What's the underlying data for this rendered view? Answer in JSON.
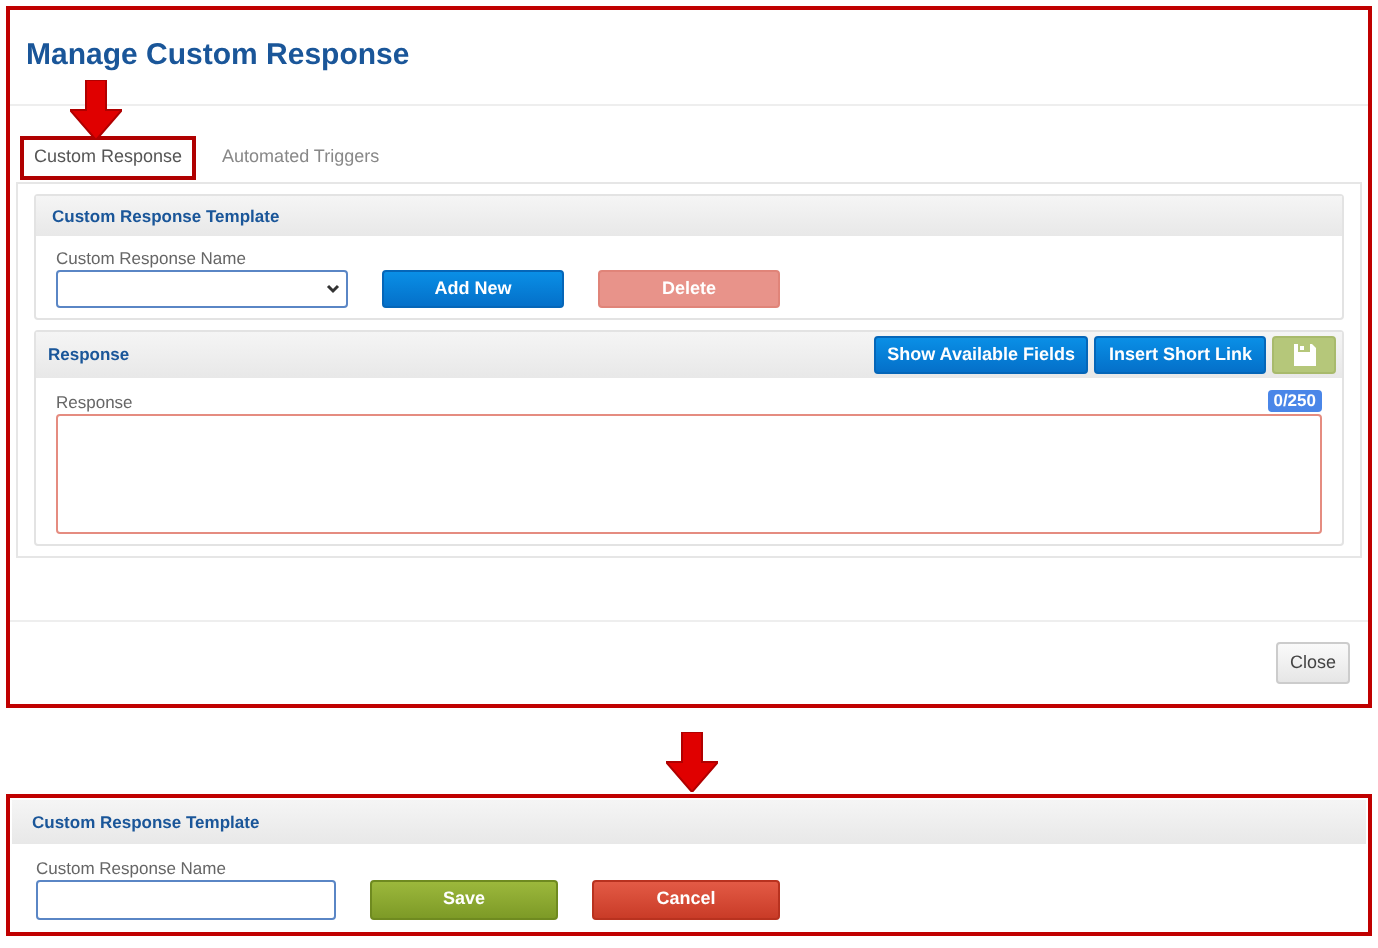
{
  "dialog": {
    "title": "Manage Custom Response",
    "tabs": [
      {
        "label": "Custom Response",
        "selected": true
      },
      {
        "label": "Automated Triggers",
        "selected": false
      }
    ],
    "template_panel": {
      "title": "Custom Response Template",
      "field_label": "Custom Response Name",
      "buttons": [
        {
          "label": "Add New",
          "kind": "primary"
        },
        {
          "label": "Delete",
          "kind": "danger-disabled"
        }
      ]
    },
    "response_panel": {
      "title": "Response",
      "buttons": [
        {
          "label": "Show Available Fields",
          "kind": "primary"
        },
        {
          "label": "Insert Short Link",
          "kind": "primary"
        },
        {
          "kind": "save-icon"
        }
      ],
      "field_label": "Response",
      "counter": "0/250"
    },
    "footer_button": "Close"
  },
  "edit_panel": {
    "title": "Custom Response Template",
    "field_label": "Custom Response Name",
    "buttons": [
      {
        "label": "Save",
        "kind": "success"
      },
      {
        "label": "Cancel",
        "kind": "danger"
      }
    ]
  }
}
